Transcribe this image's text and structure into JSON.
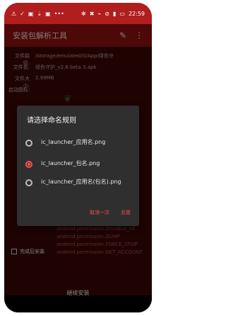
{
  "status": {
    "left_icons": [
      "warning-icon",
      "check-icon",
      "image-icon",
      "download-icon",
      "image-icon",
      "dots-icon"
    ],
    "right_icons": [
      "bluetooth-icon",
      "mute-icon",
      "wifi-icon",
      "no-sim-icon",
      "signal-icon",
      "battery-icon"
    ],
    "time": "22:59"
  },
  "appbar": {
    "title": "安装包解析工具",
    "edit_icon": "pencil-icon",
    "more_icon": "more-vert-icon"
  },
  "info": {
    "path_label": "文件路径:",
    "path_value": "/storage/emulated/0/App/绿色守",
    "name_label": "文件名:",
    "name_value": "绿色守护_v2.6 beta 3.apk",
    "size_label": "文件大小:",
    "size_value": "2.99MB",
    "icon_label": "启动图标:"
  },
  "permissions": [
    "android.permission.DISABLE_KE",
    "android.permission.DUMP",
    "android.permission.FORCE_STOP",
    "android.permission.GET_ACCOUNT"
  ],
  "bottom": {
    "checkbox_label": "完成后安装",
    "continue_label": "继续安装"
  },
  "dialog": {
    "title": "请选择命名规则",
    "options": [
      {
        "label": "ic_launcher_应用名.png",
        "checked": false
      },
      {
        "label": "ic_launcher_包名.png",
        "checked": true
      },
      {
        "label": "ic_launcher_应用名(包名).png",
        "checked": false
      }
    ],
    "cancel": "取消一次",
    "confirm": "总是"
  }
}
